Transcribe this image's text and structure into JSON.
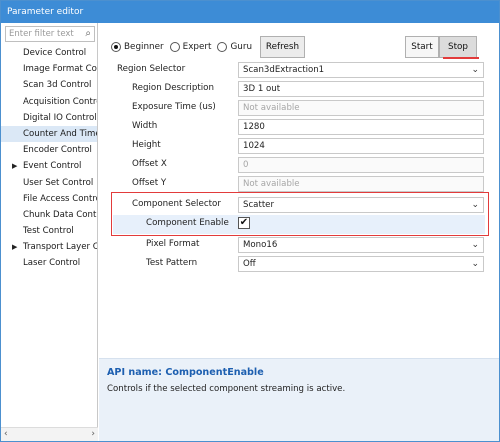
{
  "window": {
    "title": "Parameter editor"
  },
  "filter": {
    "placeholder": "Enter filter text",
    "icon": "search-icon"
  },
  "tree": [
    {
      "label": "Device Control",
      "expandable": false
    },
    {
      "label": "Image Format Con",
      "expandable": false
    },
    {
      "label": "Scan 3d Control",
      "expandable": false
    },
    {
      "label": "Acquisition Contro",
      "expandable": false
    },
    {
      "label": "Digital IO Control",
      "expandable": false
    },
    {
      "label": "Counter And Time",
      "expandable": false,
      "selected": true
    },
    {
      "label": "Encoder Control",
      "expandable": false
    },
    {
      "label": "Event Control",
      "expandable": true
    },
    {
      "label": "User Set Control",
      "expandable": false
    },
    {
      "label": "File Access Control",
      "expandable": false
    },
    {
      "label": "Chunk Data Contro",
      "expandable": false
    },
    {
      "label": "Test Control",
      "expandable": false
    },
    {
      "label": "Transport Layer Co",
      "expandable": true
    },
    {
      "label": "Laser Control",
      "expandable": false
    }
  ],
  "visibility": {
    "options": [
      "Beginner",
      "Expert",
      "Guru"
    ],
    "selected": "Beginner",
    "refresh_label": "Refresh"
  },
  "controls": {
    "start_label": "Start",
    "stop_label": "Stop"
  },
  "params": [
    {
      "label": "Region Selector",
      "value": "Scan3dExtraction1",
      "type": "dropdown"
    },
    {
      "label": "Region Description",
      "value": "3D 1 out",
      "type": "text"
    },
    {
      "label": "Exposure Time (us)",
      "value": "Not available",
      "type": "disabled"
    },
    {
      "label": "Width",
      "value": "1280",
      "type": "text"
    },
    {
      "label": "Height",
      "value": "1024",
      "type": "text"
    },
    {
      "label": "Offset X",
      "value": "0",
      "type": "disabled"
    },
    {
      "label": "Offset Y",
      "value": "Not available",
      "type": "disabled"
    },
    {
      "label": "Component Selector",
      "value": "Scatter",
      "type": "dropdown"
    },
    {
      "label": "Component Enable",
      "value": "✔",
      "type": "checkbox"
    },
    {
      "label": "Pixel Format",
      "value": "Mono16",
      "type": "dropdown"
    },
    {
      "label": "Test Pattern",
      "value": "Off",
      "type": "dropdown"
    }
  ],
  "api": {
    "name": "API name: ComponentEnable",
    "description": "Controls if the selected component streaming is active."
  },
  "colors": {
    "titlebar": "#3d8cd6",
    "highlight": "#e23b3b",
    "api_name": "#1d5fb0",
    "selected_bg": "#dbe8f6"
  }
}
